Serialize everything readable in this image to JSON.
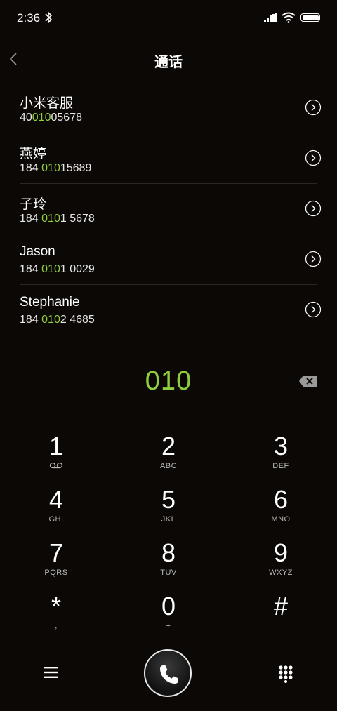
{
  "status_bar": {
    "time": "2:36"
  },
  "header": {
    "title": "通话"
  },
  "contacts": [
    {
      "name": "小米客服",
      "num_pre": "40",
      "num_hl": "010",
      "num_post": "05678"
    },
    {
      "name": "燕婷",
      "num_pre": "184 ",
      "num_hl": "010",
      "num_post": "15689"
    },
    {
      "name": "子玲",
      "num_pre": "184 ",
      "num_hl": "010",
      "num_post": "1 5678"
    },
    {
      "name": "Jason",
      "num_pre": "184 ",
      "num_hl": "010",
      "num_post": "1 0029"
    },
    {
      "name": "Stephanie",
      "num_pre": "184 ",
      "num_hl": "010",
      "num_post": "2 4685"
    }
  ],
  "dial_input": {
    "value": "010"
  },
  "keypad": [
    {
      "digit": "1",
      "letters": ""
    },
    {
      "digit": "2",
      "letters": "ABC"
    },
    {
      "digit": "3",
      "letters": "DEF"
    },
    {
      "digit": "4",
      "letters": "GHI"
    },
    {
      "digit": "5",
      "letters": "JKL"
    },
    {
      "digit": "6",
      "letters": "MNO"
    },
    {
      "digit": "7",
      "letters": "PQRS"
    },
    {
      "digit": "8",
      "letters": "TUV"
    },
    {
      "digit": "9",
      "letters": "WXYZ"
    },
    {
      "digit": "*",
      "letters": ","
    },
    {
      "digit": "0",
      "letters": "+"
    },
    {
      "digit": "#",
      "letters": ""
    }
  ],
  "colors": {
    "background": "#0c0806",
    "accent": "#8fcf3f"
  },
  "icons": {
    "key_1_sub": "voicemail-icon",
    "left": "menu-icon",
    "center": "phone-icon",
    "right": "dialpad-icon"
  }
}
